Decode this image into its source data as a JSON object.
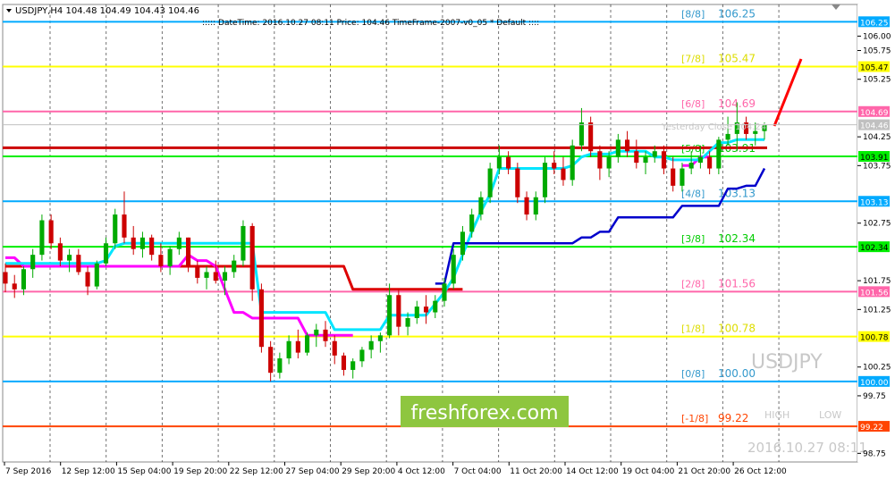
{
  "header": {
    "symbol_line": "USDJPY,H4  104.48 104.49 104.43 104.46",
    "info_line": "::::: DateTime: 2016.10.27 08:11    Price: 104.46    TimeFrame-2007-v0_05    *  Default  ::::",
    "yesterday_label": "Yesterday Close 104.24"
  },
  "watermark": {
    "symbol": "USDJPY",
    "brand": "freshforex.com",
    "high_label": "HIGH",
    "low_label": "LOW",
    "datetime": "2016.10.27 08:11"
  },
  "colors": {
    "bull": "#00aa00",
    "bear": "#cc0000",
    "cyan_line": "#00e5ff",
    "blue_line": "#0000cc",
    "magenta_line": "#ff00ff",
    "red_line": "#dd0000",
    "brand_bg": "#8ec63f"
  },
  "chart_data": {
    "type": "candlestick",
    "symbol": "USDJPY",
    "timeframe": "H4",
    "ylim": [
      98.6,
      106.55
    ],
    "current_price": 104.46,
    "price_axis_ticks": [
      "106.00",
      "105.75",
      "105.25",
      "104.75",
      "104.25",
      "103.75",
      "103.25",
      "102.75",
      "102.25",
      "101.75",
      "101.25",
      "100.75",
      "100.25",
      "99.75",
      "99.25",
      "98.75"
    ],
    "x_labels": [
      "7 Sep 2016",
      "12 Sep 12:00",
      "15 Sep 04:00",
      "19 Sep 20:00",
      "22 Sep 12:00",
      "27 Sep 04:00",
      "29 Sep 20:00",
      "4 Oct 12:00",
      "7 Oct 04:00",
      "11 Oct 20:00",
      "14 Oct 12:00",
      "19 Oct 04:00",
      "21 Oct 20:00",
      "26 Oct 12:00"
    ],
    "murrey_levels": [
      {
        "label": "[8/8]",
        "value": "106.25",
        "tag": "106.25",
        "color": "#00aaff",
        "text_color": "#3399cc"
      },
      {
        "label": "[7/8]",
        "value": "105.47",
        "tag": "105.47",
        "color": "#ffff00",
        "text_color": "#dddd00"
      },
      {
        "label": "[6/8]",
        "value": "104.69",
        "tag": "104.69",
        "color": "#ff66aa",
        "text_color": "#ff66aa"
      },
      {
        "label": "[5/8]",
        "value": "103.91",
        "tag": "103.91",
        "color": "#00ee00",
        "text_color": "#00cc00"
      },
      {
        "label": "[4/8]",
        "value": "103.13",
        "tag": "103.13",
        "color": "#00aaff",
        "text_color": "#3399cc"
      },
      {
        "label": "[3/8]",
        "value": "102.34",
        "tag": "102.34",
        "color": "#00ee00",
        "text_color": "#00cc00"
      },
      {
        "label": "[2/8]",
        "value": "101.56",
        "tag": "101.56",
        "color": "#ff66aa",
        "text_color": "#ff66aa"
      },
      {
        "label": "[1/8]",
        "value": "100.78",
        "tag": "100.78",
        "color": "#ffff00",
        "text_color": "#dddd00"
      },
      {
        "label": "[0/8]",
        "value": "100.00",
        "tag": "100.00",
        "color": "#00aaff",
        "text_color": "#3399cc"
      },
      {
        "label": "[-1/8]",
        "value": "99.22",
        "tag": "99.22",
        "color": "#ff4400",
        "text_color": "#ff4400"
      }
    ],
    "candles": [
      [
        101.9,
        102.05,
        101.55,
        101.7
      ],
      [
        101.7,
        101.85,
        101.45,
        101.6
      ],
      [
        101.6,
        102.0,
        101.5,
        101.95
      ],
      [
        101.95,
        102.3,
        101.8,
        102.2
      ],
      [
        102.2,
        102.9,
        102.1,
        102.8
      ],
      [
        102.8,
        102.9,
        102.3,
        102.4
      ],
      [
        102.4,
        102.5,
        102.0,
        102.1
      ],
      [
        102.1,
        102.3,
        101.9,
        102.2
      ],
      [
        102.2,
        102.3,
        101.85,
        101.9
      ],
      [
        101.9,
        102.0,
        101.5,
        101.65
      ],
      [
        101.65,
        102.1,
        101.6,
        102.05
      ],
      [
        102.05,
        102.5,
        102.0,
        102.4
      ],
      [
        102.4,
        103.0,
        102.3,
        102.9
      ],
      [
        102.9,
        103.3,
        102.4,
        102.5
      ],
      [
        102.5,
        102.7,
        102.2,
        102.3
      ],
      [
        102.3,
        102.6,
        102.15,
        102.5
      ],
      [
        102.5,
        102.55,
        102.1,
        102.2
      ],
      [
        102.2,
        102.4,
        101.9,
        102.0
      ],
      [
        102.0,
        102.35,
        101.85,
        102.3
      ],
      [
        102.3,
        102.6,
        102.2,
        102.5
      ],
      [
        102.5,
        102.5,
        101.9,
        102.0
      ],
      [
        102.0,
        102.1,
        101.7,
        101.8
      ],
      [
        101.8,
        102.0,
        101.6,
        101.9
      ],
      [
        101.9,
        102.1,
        101.7,
        101.75
      ],
      [
        101.75,
        102.0,
        101.5,
        101.9
      ],
      [
        101.9,
        102.2,
        101.8,
        102.1
      ],
      [
        102.1,
        102.8,
        102.0,
        102.7
      ],
      [
        102.7,
        102.75,
        101.4,
        101.6
      ],
      [
        101.6,
        101.7,
        100.5,
        100.6
      ],
      [
        100.6,
        100.7,
        100.0,
        100.15
      ],
      [
        100.15,
        100.5,
        100.05,
        100.4
      ],
      [
        100.4,
        100.8,
        100.3,
        100.7
      ],
      [
        100.7,
        100.9,
        100.4,
        100.5
      ],
      [
        100.5,
        100.85,
        100.45,
        100.8
      ],
      [
        100.8,
        101.0,
        100.6,
        100.9
      ],
      [
        100.9,
        101.05,
        100.6,
        100.7
      ],
      [
        100.7,
        100.8,
        100.3,
        100.45
      ],
      [
        100.45,
        100.5,
        100.1,
        100.2
      ],
      [
        100.2,
        100.4,
        100.05,
        100.35
      ],
      [
        100.35,
        100.6,
        100.25,
        100.55
      ],
      [
        100.55,
        100.8,
        100.4,
        100.7
      ],
      [
        100.7,
        100.85,
        100.5,
        100.8
      ],
      [
        100.8,
        101.7,
        100.75,
        101.5
      ],
      [
        101.5,
        101.6,
        100.8,
        100.95
      ],
      [
        100.95,
        101.2,
        100.8,
        101.1
      ],
      [
        101.1,
        101.4,
        101.0,
        101.3
      ],
      [
        101.3,
        101.5,
        101.0,
        101.2
      ],
      [
        101.2,
        101.5,
        101.1,
        101.4
      ],
      [
        101.4,
        101.8,
        101.3,
        101.7
      ],
      [
        101.7,
        102.3,
        101.6,
        102.2
      ],
      [
        102.2,
        102.7,
        102.1,
        102.6
      ],
      [
        102.6,
        103.0,
        102.5,
        102.9
      ],
      [
        102.9,
        103.3,
        102.8,
        103.2
      ],
      [
        103.2,
        103.8,
        103.1,
        103.7
      ],
      [
        103.7,
        104.1,
        103.6,
        103.9
      ],
      [
        103.9,
        104.0,
        103.6,
        103.7
      ],
      [
        103.7,
        103.8,
        103.1,
        103.2
      ],
      [
        103.2,
        103.3,
        102.8,
        102.9
      ],
      [
        102.9,
        103.3,
        102.8,
        103.2
      ],
      [
        103.2,
        103.9,
        103.1,
        103.8
      ],
      [
        103.8,
        104.0,
        103.6,
        103.7
      ],
      [
        103.7,
        103.9,
        103.4,
        103.5
      ],
      [
        103.5,
        104.2,
        103.4,
        104.1
      ],
      [
        104.1,
        104.75,
        104.0,
        104.5
      ],
      [
        104.5,
        104.6,
        103.9,
        104.0
      ],
      [
        104.0,
        104.1,
        103.5,
        103.7
      ],
      [
        103.7,
        104.0,
        103.55,
        103.9
      ],
      [
        103.9,
        104.3,
        103.8,
        104.2
      ],
      [
        104.2,
        104.35,
        103.9,
        104.0
      ],
      [
        104.0,
        104.2,
        103.7,
        103.8
      ],
      [
        103.8,
        104.0,
        103.6,
        103.9
      ],
      [
        103.9,
        104.1,
        103.8,
        104.0
      ],
      [
        104.0,
        104.1,
        103.6,
        103.7
      ],
      [
        103.7,
        103.9,
        103.3,
        103.4
      ],
      [
        103.4,
        103.8,
        103.3,
        103.7
      ],
      [
        103.7,
        104.0,
        103.6,
        103.8
      ],
      [
        103.8,
        104.1,
        103.7,
        103.9
      ],
      [
        103.9,
        104.0,
        103.6,
        103.7
      ],
      [
        103.7,
        104.25,
        103.6,
        104.2
      ],
      [
        104.2,
        104.6,
        104.1,
        104.3
      ],
      [
        104.3,
        104.85,
        104.0,
        104.5
      ],
      [
        104.5,
        104.6,
        104.2,
        104.3
      ],
      [
        104.3,
        104.5,
        104.1,
        104.35
      ],
      [
        104.35,
        104.5,
        104.2,
        104.46
      ]
    ],
    "cyan_line": [
      102.05,
      102.05,
      102.05,
      102.05,
      102.05,
      102.05,
      102.05,
      102.05,
      102.05,
      102.05,
      102.05,
      102.1,
      102.35,
      102.4,
      102.4,
      102.4,
      102.4,
      102.4,
      102.4,
      102.4,
      102.4,
      102.4,
      102.4,
      102.4,
      102.4,
      102.4,
      102.4,
      102.4,
      101.2,
      101.2,
      101.2,
      101.2,
      101.2,
      101.2,
      101.2,
      101.2,
      100.9,
      100.9,
      100.9,
      100.9,
      100.9,
      100.9,
      101.15,
      101.15,
      101.15,
      101.15,
      101.15,
      101.35,
      101.55,
      101.8,
      102.2,
      102.6,
      102.95,
      103.25,
      103.7,
      103.7,
      103.7,
      103.7,
      103.7,
      103.7,
      103.7,
      103.7,
      103.75,
      103.9,
      103.95,
      103.95,
      103.95,
      104.0,
      104.0,
      104.0,
      104.0,
      103.9,
      103.9,
      103.85,
      103.85,
      103.85,
      103.85,
      104.0,
      104.15,
      104.15,
      104.2,
      104.2,
      104.2,
      104.2
    ],
    "blue_line": [
      null,
      null,
      null,
      null,
      null,
      null,
      null,
      null,
      null,
      null,
      null,
      null,
      null,
      null,
      null,
      null,
      null,
      null,
      null,
      null,
      null,
      null,
      null,
      null,
      null,
      null,
      null,
      null,
      null,
      null,
      null,
      null,
      null,
      null,
      null,
      null,
      null,
      null,
      null,
      null,
      null,
      null,
      null,
      null,
      null,
      null,
      null,
      101.7,
      101.7,
      102.4,
      102.4,
      102.4,
      102.4,
      102.4,
      102.4,
      102.4,
      102.4,
      102.4,
      102.4,
      102.4,
      102.4,
      102.4,
      102.4,
      102.5,
      102.5,
      102.6,
      102.6,
      102.85,
      102.85,
      102.85,
      102.85,
      102.85,
      102.85,
      102.85,
      103.05,
      103.05,
      103.05,
      103.05,
      103.05,
      103.35,
      103.35,
      103.4,
      103.4,
      103.7
    ],
    "magenta_line": [
      102.15,
      102.15,
      102.0,
      102.0,
      102.0,
      102.0,
      102.0,
      102.0,
      102.0,
      102.0,
      102.0,
      102.0,
      102.0,
      102.0,
      102.0,
      102.0,
      102.0,
      102.0,
      102.0,
      102.0,
      102.2,
      102.1,
      102.1,
      102.0,
      101.6,
      101.2,
      101.2,
      101.1,
      101.1,
      101.1,
      101.1,
      101.1,
      101.1,
      100.8,
      100.8,
      100.8,
      100.8,
      100.8,
      100.8,
      null,
      null,
      null,
      null,
      null,
      null,
      null,
      null,
      null,
      null,
      null,
      null,
      null,
      null,
      null,
      null,
      null,
      null,
      null,
      null,
      null,
      null,
      null,
      null,
      null,
      null,
      null,
      null,
      null,
      null,
      null,
      null,
      null,
      null,
      null,
      103.75,
      103.75,
      103.9,
      103.9,
      null,
      null,
      null,
      null,
      null,
      null
    ],
    "red_line": [
      102.0,
      102.0,
      102.0,
      102.0,
      102.0,
      102.0,
      102.0,
      102.0,
      102.0,
      102.0,
      102.0,
      102.0,
      102.0,
      102.0,
      102.0,
      102.0,
      102.0,
      102.0,
      102.0,
      102.0,
      102.0,
      102.0,
      102.0,
      102.0,
      102.0,
      102.0,
      102.0,
      102.0,
      102.0,
      102.0,
      102.0,
      102.0,
      102.0,
      102.0,
      102.0,
      102.0,
      102.0,
      102.0,
      101.6,
      101.6,
      101.6,
      101.6,
      101.6,
      101.6,
      101.6,
      101.6,
      101.6,
      101.6,
      101.6,
      101.6,
      101.6,
      null,
      null,
      null,
      null,
      null,
      null,
      null,
      null,
      null,
      null,
      null,
      null,
      null,
      null,
      null,
      null,
      null,
      null,
      null,
      null,
      null,
      null,
      null,
      null,
      null,
      null,
      null,
      null,
      null,
      null,
      null,
      null,
      null
    ]
  }
}
